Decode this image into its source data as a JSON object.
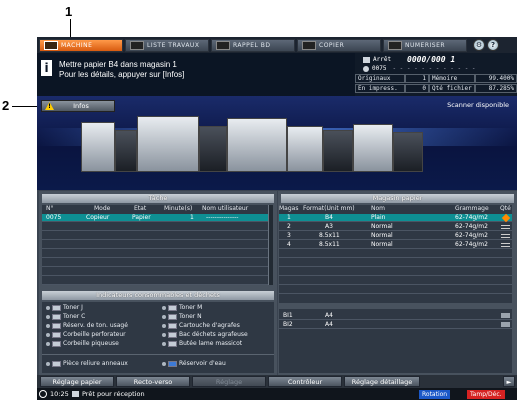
{
  "callouts": {
    "one": "1",
    "two": "2"
  },
  "tabs": [
    {
      "label": "MACHINE",
      "icon": "machine-icon"
    },
    {
      "label": "LISTE TRAVAUX",
      "icon": "job-list-icon"
    },
    {
      "label": "RAPPEL BD",
      "icon": "recall-icon"
    },
    {
      "label": "COPIER",
      "icon": "copy-icon"
    },
    {
      "label": "NUMERISER",
      "icon": "scan-icon"
    }
  ],
  "message": {
    "line1": "Mettre papier B4 dans magasin 1",
    "line2": "Pour les détails, appuyer sur [Infos]"
  },
  "status": {
    "state": "Arrêt",
    "counter": "0000/000 1",
    "user": "0075",
    "rows": [
      {
        "label": "Originaux",
        "value": "1",
        "label2": "Mémoire",
        "value2": "99.400%"
      },
      {
        "label": "En impress.",
        "value": "0",
        "label2": "Qté fichier",
        "value2": "87.285%"
      }
    ]
  },
  "infos": {
    "label": "Infos"
  },
  "banner": {
    "scanner": "Scanner disponible"
  },
  "tache": {
    "title": "Tâche",
    "headers": {
      "n": "N°",
      "mode": "Mode",
      "etat": "Etat",
      "minutes": "Minute(s)",
      "user": "Nom utilisateur"
    },
    "rows": [
      {
        "n": "0075",
        "mode": "Copieur",
        "etat": "Papier",
        "minutes": "1",
        "user": "---------------"
      }
    ]
  },
  "consommables": {
    "title": "Indicateurs consommables et déchets",
    "left": [
      "Toner J",
      "Toner C",
      "Réserv. de ton. usagé",
      "Corbeille perforateur",
      "Corbeille piqueuse"
    ],
    "right": [
      "Toner M",
      "Toner N",
      "Cartouche d'agrafes",
      "Bac déchets agrafeuse",
      "Butée lame massicot"
    ],
    "bottom_left": "Pièce reliure anneaux",
    "bottom_right": "Réservoir d'eau"
  },
  "magasin": {
    "title": "Magasin papier",
    "headers": {
      "mag": "Magas",
      "format": "Format(Unit mm)",
      "nom": "Nom",
      "grammage": "Grammage",
      "qte": "Qté"
    },
    "rows": [
      {
        "mag": "1",
        "format": "B4",
        "nom": "Plain",
        "grammage": "62-74g/m2"
      },
      {
        "mag": "2",
        "format": "A3",
        "nom": "Normal",
        "grammage": "62-74g/m2"
      },
      {
        "mag": "3",
        "format": "8.5x11",
        "nom": "Normal",
        "grammage": "62-74g/m2"
      },
      {
        "mag": "4",
        "format": "8.5x11",
        "nom": "Normal",
        "grammage": "62-74g/m2"
      }
    ],
    "bypass": [
      {
        "mag": "BI1",
        "format": "A4"
      },
      {
        "mag": "BI2",
        "format": "A4"
      }
    ]
  },
  "buttons": {
    "reglage_papier": "Réglage papier",
    "recto_verso": "Recto-verso",
    "reglage": "Réglage",
    "controleur": "Contrôleur",
    "reglage_detaillage": "Réglage détaillage"
  },
  "statusline": {
    "time": "10:25",
    "text": "Prêt pour réception",
    "rotation": "Rotation",
    "tampon": "Tamp/Déc."
  }
}
